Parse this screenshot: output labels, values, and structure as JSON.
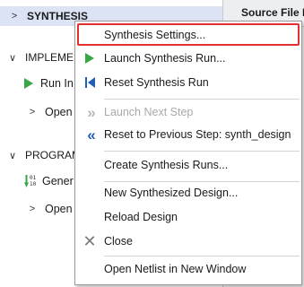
{
  "navigator": {
    "synthesis_label": "SYNTHESIS",
    "implementation_label": "IMPLEMEN",
    "run_impl_label": "Run In",
    "open_impl_label": "Open",
    "program_label": "PROGRAM",
    "generate_label": "Gener",
    "open_hw_label": "Open",
    "bitstream_digits": "01\n10"
  },
  "right_panel": {
    "tab_label": "Source File P"
  },
  "context_menu": {
    "items": [
      {
        "label": "Synthesis Settings...",
        "icon": "none",
        "enabled": true
      },
      {
        "label": "Launch Synthesis Run...",
        "icon": "play-icon",
        "enabled": true
      },
      {
        "label": "Reset Synthesis Run",
        "icon": "reset-icon",
        "enabled": true
      },
      {
        "label": "Launch Next Step",
        "icon": "double-chevron-right-icon",
        "enabled": false
      },
      {
        "label": "Reset to Previous Step: synth_design",
        "icon": "double-chevron-left-icon",
        "enabled": true
      },
      {
        "label": "Create Synthesis Runs...",
        "icon": "none",
        "enabled": true
      },
      {
        "label": "New Synthesized Design...",
        "icon": "none",
        "enabled": true
      },
      {
        "label": "Reload Design",
        "icon": "none",
        "enabled": true
      },
      {
        "label": "Close",
        "icon": "close-icon",
        "enabled": true
      },
      {
        "label": "Open Netlist in New Window",
        "icon": "none",
        "enabled": true
      }
    ]
  },
  "colors": {
    "highlight": "#e23030",
    "play_green": "#35a744",
    "icon_blue": "#1e5fb5",
    "selected_row": "#dbe3f5"
  }
}
